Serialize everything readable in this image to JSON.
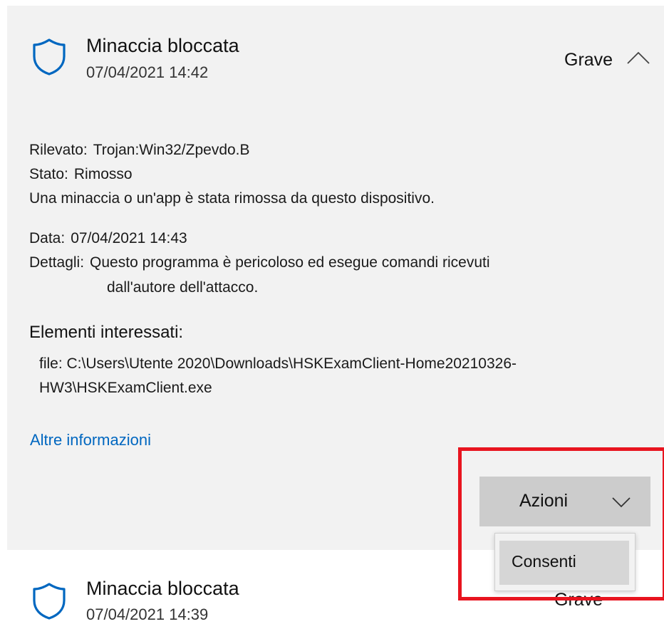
{
  "threat1": {
    "title": "Minaccia bloccata",
    "date": "07/04/2021 14:42",
    "severity": "Grave",
    "expanded_icon": "chevron-up-icon",
    "shield_icon": "shield-icon",
    "detected_label": "Rilevato:",
    "detected_value": "Trojan:Win32/Zpevdo.B",
    "status_label": "Stato:",
    "status_value": "Rimosso",
    "status_desc": "Una minaccia o un'app è stata rimossa da questo dispositivo.",
    "data_label": "Data:",
    "data_value": "07/04/2021 14:43",
    "details_label": "Dettagli:",
    "details_line1": "Questo programma è pericoloso ed esegue comandi ricevuti",
    "details_line2": "dall'autore dell'attacco.",
    "affected_title": "Elementi interessati:",
    "file_line1": "file: C:\\Users\\Utente 2020\\Downloads\\HSKExamClient-Home20210326-",
    "file_line2": "HW3\\HSKExamClient.exe",
    "more_info": "Altre informazioni",
    "actions_label": "Azioni",
    "actions_icon": "chevron-down-icon",
    "menu_items": [
      "Consenti"
    ]
  },
  "threat2": {
    "title": "Minaccia bloccata",
    "date": "07/04/2021 14:39",
    "severity": "Grave"
  },
  "colors": {
    "accent": "#0067c0",
    "card_bg": "#f2f2f2",
    "highlight": "#e8141f",
    "button_bg": "#cccccc"
  }
}
